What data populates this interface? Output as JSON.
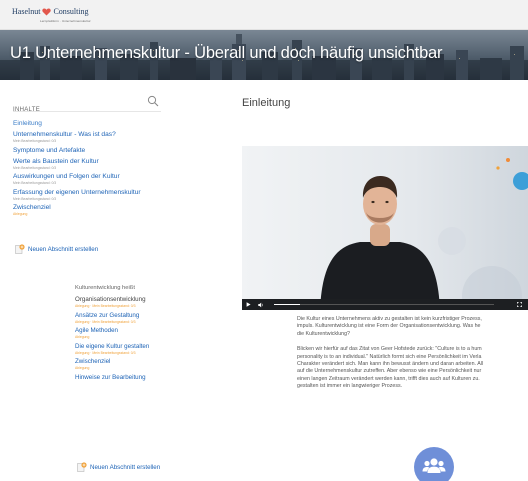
{
  "brand": {
    "name": "Haselnut",
    "name2": "Consulting",
    "tagline": "Lernplattform · Unternehmenskultur",
    "heart_color": "#e2574c",
    "text_color": "#1f3c63"
  },
  "banner": {
    "title": "U1 Unternehmenskultur - Überall und doch häufig unsichtbar"
  },
  "sidebar": {
    "heading": "INHALTE",
    "search_icon": "search-icon",
    "items": [
      {
        "title": "Einleitung",
        "sub": ""
      },
      {
        "title": "Unternehmenskultur - Was ist das?",
        "sub": "Mein Bearbeitungsstand: 0/3"
      },
      {
        "title": "Symptome und Artefakte",
        "sub": ""
      },
      {
        "title": "Werte als Baustein der Kultur",
        "sub": "Mein Bearbeitungsstand: 0/3"
      },
      {
        "title": "Auswirkungen und Folgen der Kultur",
        "sub": "Mein Bearbeitungsstand: 0/3"
      },
      {
        "title": "Erfassung der eigenen Unternehmenskultur",
        "sub": "Mein Bearbeitungsstand: 0/3"
      },
      {
        "title": "Zwischenziel",
        "sub": "Ablegung"
      }
    ],
    "new_section_label": "Neuen Abschnitt erstellen",
    "group2": {
      "intro": "Kulturentwicklung heißt",
      "items": [
        {
          "title": "Organisationsentwicklung",
          "sub": "Ablegung · Mein Bearbeitungsstand: 0/3"
        },
        {
          "title": "Ansätze zur Gestaltung",
          "sub": "Ablegung · Mein Bearbeitungsstand: 0/3"
        },
        {
          "title": "Agile Methoden",
          "sub": "Ablegung"
        },
        {
          "title": "Die eigene Kultur gestalten",
          "sub": "Ablegung · Mein Bearbeitungsstand: 0/3"
        },
        {
          "title": "Zwischenziel",
          "sub": "Ablegung"
        },
        {
          "title": "Hinweise zur Bearbeitung",
          "sub": ""
        }
      ],
      "new_section_label": "Neuen Abschnitt erstellen"
    }
  },
  "main": {
    "title": "Einleitung",
    "video": {
      "progress": 0.12
    },
    "paragraphs": [
      [
        "Die Kultur eines Unternehmens aktiv zu gestalten ist kein kurzfristiger Prozess,",
        "impuls. Kulturentwicklung ist eine Form der Organisationsentwicklung. Was he",
        "die Kulturentwicklung?"
      ],
      [
        "Blicken wir hierfür auf das Zitat von Geer Hofstede zurück: \"Culture is to a hum",
        "personality is to an individual.\" Natürlich formt sich eine Persönlichkeit im Verla",
        "Charakter verändert sich. Man kann ihn bewusst ändern und daran arbeiten. All",
        "auf die Unternehmenskultur zutreffen. Aber ebenso wie eine Persönlichkeit nur",
        "einen langen Zeitraum verändert werden kann, trifft dies auch auf Kulturen zu.",
        "gestalten ist immer ein langwieriger Prozess."
      ]
    ],
    "group_icon": "group-icon",
    "accent": "#6f8fd8"
  }
}
